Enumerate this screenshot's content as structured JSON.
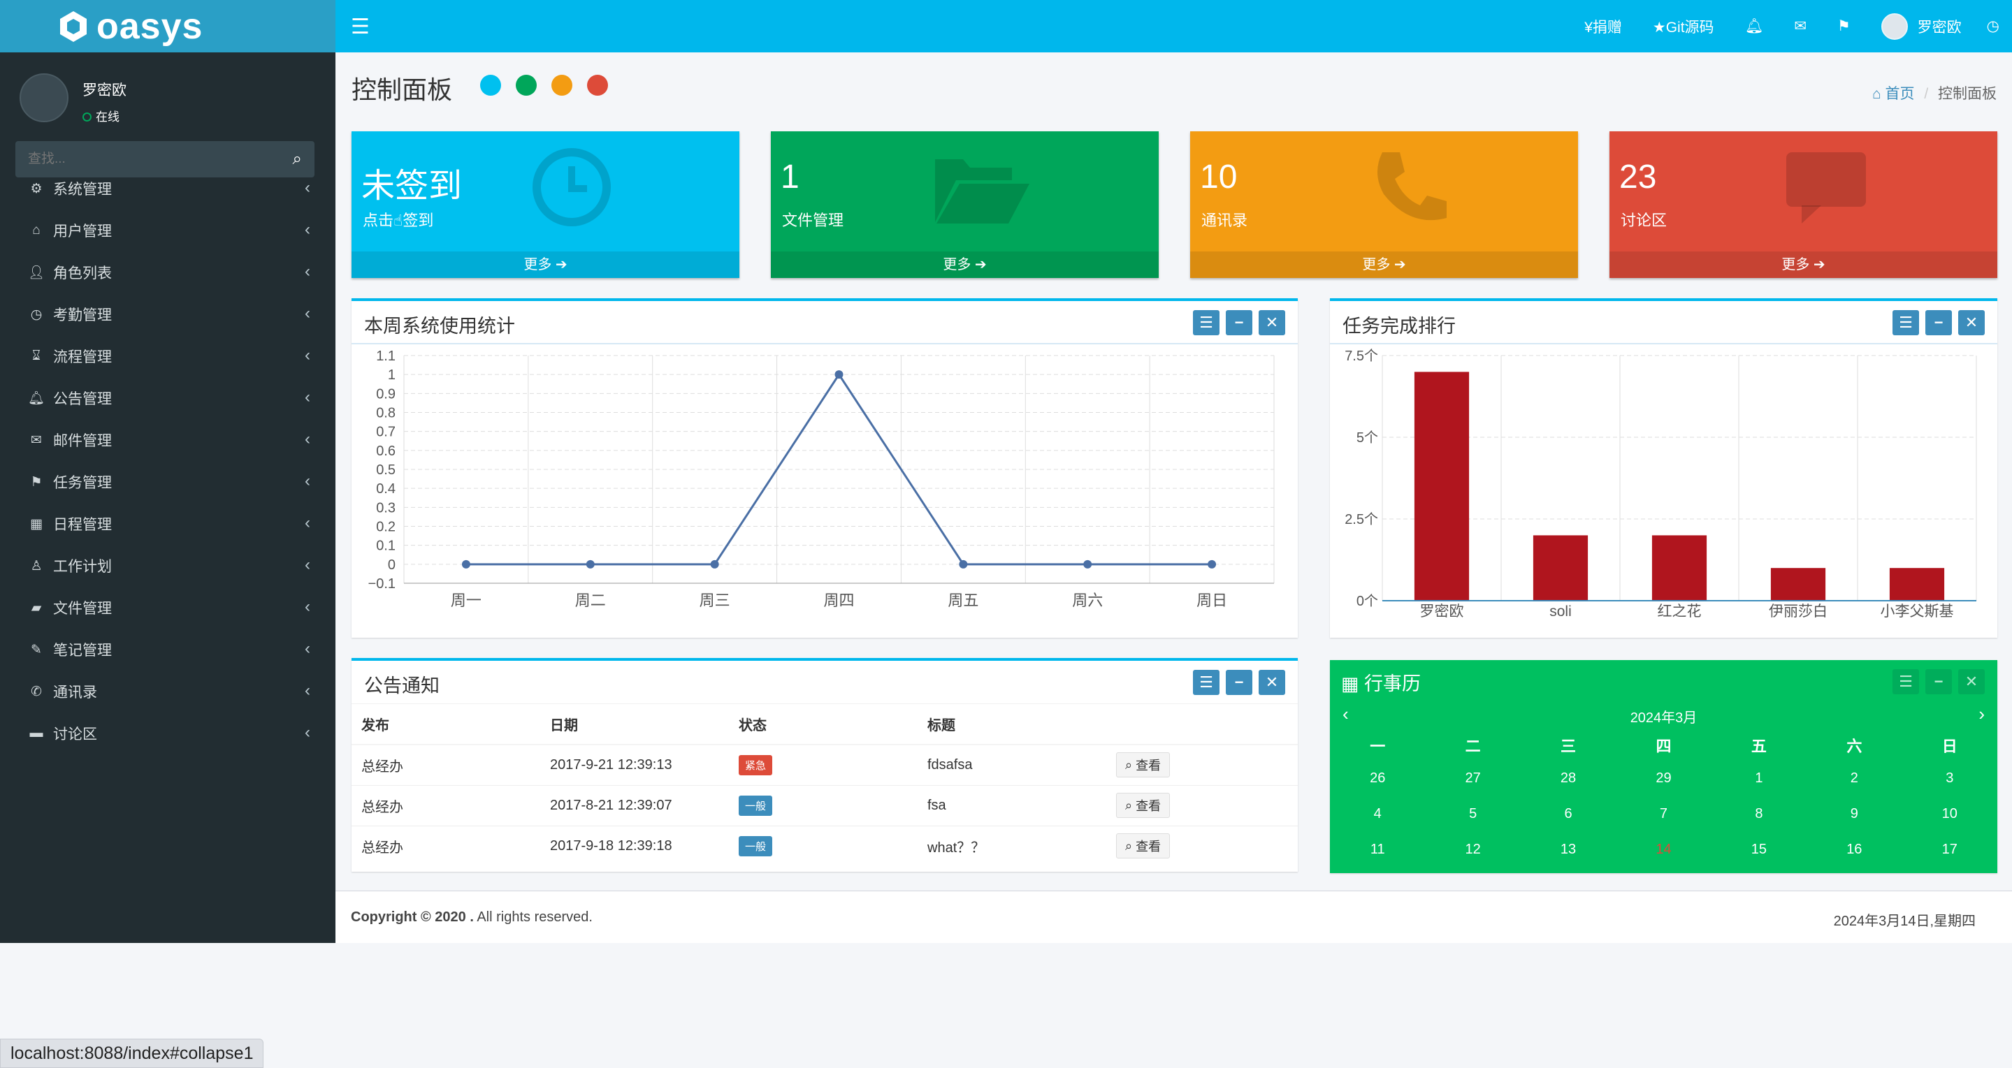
{
  "app": {
    "logo_text": "oasys"
  },
  "topbar": {
    "donate": "¥捐赠",
    "git": "★Git源码",
    "username": "罗密欧"
  },
  "sidebar": {
    "user": {
      "name": "罗密欧",
      "status": "在线"
    },
    "search_placeholder": "查找...",
    "items": [
      {
        "label": "系统管理",
        "icon": "gear-icon"
      },
      {
        "label": "用户管理",
        "icon": "graduation-cap-icon"
      },
      {
        "label": "角色列表",
        "icon": "user-icon"
      },
      {
        "label": "考勤管理",
        "icon": "clock-icon"
      },
      {
        "label": "流程管理",
        "icon": "hourglass-icon"
      },
      {
        "label": "公告管理",
        "icon": "bell-icon"
      },
      {
        "label": "邮件管理",
        "icon": "envelope-icon"
      },
      {
        "label": "任务管理",
        "icon": "flag-icon"
      },
      {
        "label": "日程管理",
        "icon": "calendar-icon"
      },
      {
        "label": "工作计划",
        "icon": "person-icon"
      },
      {
        "label": "文件管理",
        "icon": "folder-icon"
      },
      {
        "label": "笔记管理",
        "icon": "edit-icon"
      },
      {
        "label": "通讯录",
        "icon": "phone-icon"
      },
      {
        "label": "讨论区",
        "icon": "comment-icon"
      }
    ]
  },
  "page": {
    "title": "控制面板",
    "breadcrumb_home": "首页",
    "breadcrumb_current": "控制面板",
    "theme_colors": [
      "#00c0ef",
      "#00a65a",
      "#f39c12",
      "#dd4b39"
    ]
  },
  "small_boxes": [
    {
      "value": "未签到",
      "label": "点击☝签到",
      "more": "更多",
      "color": "#00c0ef",
      "icon": "clock-icon"
    },
    {
      "value": "1",
      "label": "文件管理",
      "more": "更多",
      "color": "#00a65a",
      "icon": "folder-open-icon"
    },
    {
      "value": "10",
      "label": "通讯录",
      "more": "更多",
      "color": "#f39c12",
      "icon": "phone-icon"
    },
    {
      "value": "23",
      "label": "讨论区",
      "more": "更多",
      "color": "#dd4b39",
      "icon": "comment-icon"
    }
  ],
  "usage_box": {
    "title": "本周系统使用统计"
  },
  "rank_box": {
    "title": "任务完成排行"
  },
  "notice_box": {
    "title": "公告通知",
    "columns": [
      "发布",
      "日期",
      "状态",
      "标题"
    ],
    "rows": [
      {
        "from": "总经办",
        "date": "2017-9-21 12:39:13",
        "status": "紧急",
        "status_color": "#dd4b39",
        "title": "fdsafsa",
        "action": "查看"
      },
      {
        "from": "总经办",
        "date": "2017-8-21 12:39:07",
        "status": "一般",
        "status_color": "#3c8dbc",
        "title": "fsa",
        "action": "查看"
      },
      {
        "from": "总经办",
        "date": "2017-9-18 12:39:18",
        "status": "一般",
        "status_color": "#3c8dbc",
        "title": "what？？",
        "action": "查看"
      }
    ]
  },
  "calendar": {
    "title": "行事历",
    "month": "2024年3月",
    "weekdays": [
      "一",
      "二",
      "三",
      "四",
      "五",
      "六",
      "日"
    ],
    "weeks": [
      [
        "26",
        "27",
        "28",
        "29",
        "1",
        "2",
        "3"
      ],
      [
        "4",
        "5",
        "6",
        "7",
        "8",
        "9",
        "10"
      ],
      [
        "11",
        "12",
        "13",
        "14",
        "15",
        "16",
        "17"
      ]
    ],
    "today": "14"
  },
  "footer": {
    "copyright": "Copyright © 2020 .",
    "rights": " All rights reserved.",
    "date": "2024年3月14日,星期四"
  },
  "statusbar": {
    "url": "localhost:8088/index#collapse1"
  },
  "chart_data": [
    {
      "type": "line",
      "title": "本周系统使用统计",
      "categories": [
        "周一",
        "周二",
        "周三",
        "周四",
        "周五",
        "周六",
        "周日"
      ],
      "series": [
        {
          "values": [
            0,
            0,
            0,
            1,
            0,
            0,
            0
          ]
        }
      ],
      "ylim": [
        -0.1,
        1.1
      ],
      "yticks": [
        "1.1",
        "1",
        "0.9",
        "0.8",
        "0.7",
        "0.6",
        "0.5",
        "0.4",
        "0.3",
        "0.2",
        "0.1",
        "0",
        "−0.1"
      ],
      "color": "#4a6fa5",
      "grid": true
    },
    {
      "type": "bar",
      "title": "任务完成排行",
      "categories": [
        "罗密欧",
        "soli",
        "红之花",
        "伊丽莎白",
        "小李父斯基"
      ],
      "values": [
        7,
        2,
        2,
        1,
        1
      ],
      "ylim": [
        0,
        7.5
      ],
      "yticks": [
        "7.5个",
        "5个",
        "2.5个",
        "0个"
      ],
      "color": "#b0151e",
      "grid": true
    }
  ]
}
